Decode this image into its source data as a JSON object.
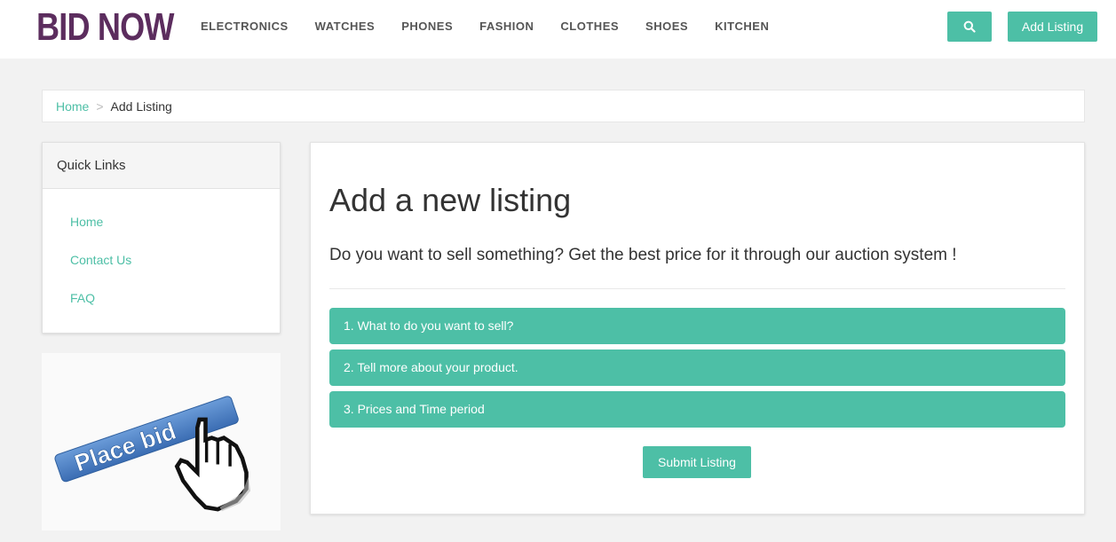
{
  "header": {
    "logo": "BID NOW",
    "nav": [
      "ELECTRONICS",
      "WATCHES",
      "PHONES",
      "FASHION",
      "CLOTHES",
      "SHOES",
      "KITCHEN"
    ],
    "add_listing_label": "Add Listing",
    "search_icon": "search-icon"
  },
  "breadcrumb": {
    "home": "Home",
    "separator": ">",
    "current": "Add Listing"
  },
  "sidebar": {
    "title": "Quick Links",
    "links": [
      "Home",
      "Contact Us",
      "FAQ"
    ],
    "banner_text": "Place bid"
  },
  "main": {
    "title": "Add a new listing",
    "subtitle": "Do you want to sell something? Get the best price for it through our auction system !",
    "steps": [
      "1. What to do you want to sell?",
      "2. Tell more about your product.",
      "3. Prices and Time period"
    ],
    "submit_label": "Submit Listing"
  },
  "colors": {
    "accent": "#4dbfa6",
    "logo": "#5c2d5e",
    "banner_blue": "#4a7fc4"
  }
}
